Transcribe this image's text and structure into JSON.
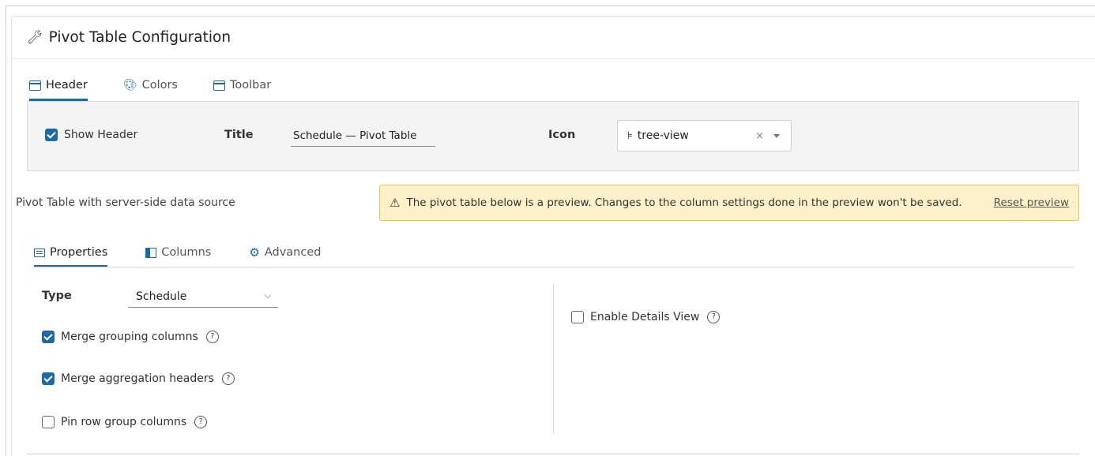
{
  "header": {
    "title": "Pivot Table Configuration",
    "icon": "wrench-icon"
  },
  "top_tabs": [
    {
      "label": "Header",
      "icon": "window-icon",
      "active": true
    },
    {
      "label": "Colors",
      "icon": "palette-icon",
      "active": false
    },
    {
      "label": "Toolbar",
      "icon": "toolbar-icon",
      "active": false
    }
  ],
  "header_panel": {
    "show_header_label": "Show Header",
    "show_header_checked": true,
    "title_label": "Title",
    "title_value": "Schedule — Pivot Table",
    "icon_label": "Icon",
    "icon_value": "tree-view",
    "icon_value_icon": "tree-view-icon",
    "clear_symbol": "×"
  },
  "data_source_text": "Pivot Table with server-side data source",
  "warning": {
    "icon": "warning-icon",
    "message": "The pivot table below is a preview. Changes to the column settings done in the preview won't be saved.",
    "reset_label": "Reset preview"
  },
  "sub_tabs": [
    {
      "label": "Properties",
      "icon": "list-icon",
      "active": true
    },
    {
      "label": "Columns",
      "icon": "columns-icon",
      "active": false
    },
    {
      "label": "Advanced",
      "icon": "gear-icon",
      "active": false
    }
  ],
  "properties": {
    "type_label": "Type",
    "type_value": "Schedule",
    "options": [
      {
        "label": "Merge grouping columns",
        "checked": true
      },
      {
        "label": "Merge aggregation headers",
        "checked": true
      },
      {
        "label": "Pin row group columns",
        "checked": false
      }
    ],
    "right_options": [
      {
        "label": "Enable Details View",
        "checked": false
      }
    ],
    "help_symbol": "?"
  },
  "colors": {
    "accent": "#1a6aa8",
    "checkbox": "#1f6aa5",
    "warning_bg": "#fcf1c8",
    "warning_border": "#e6c35a"
  }
}
